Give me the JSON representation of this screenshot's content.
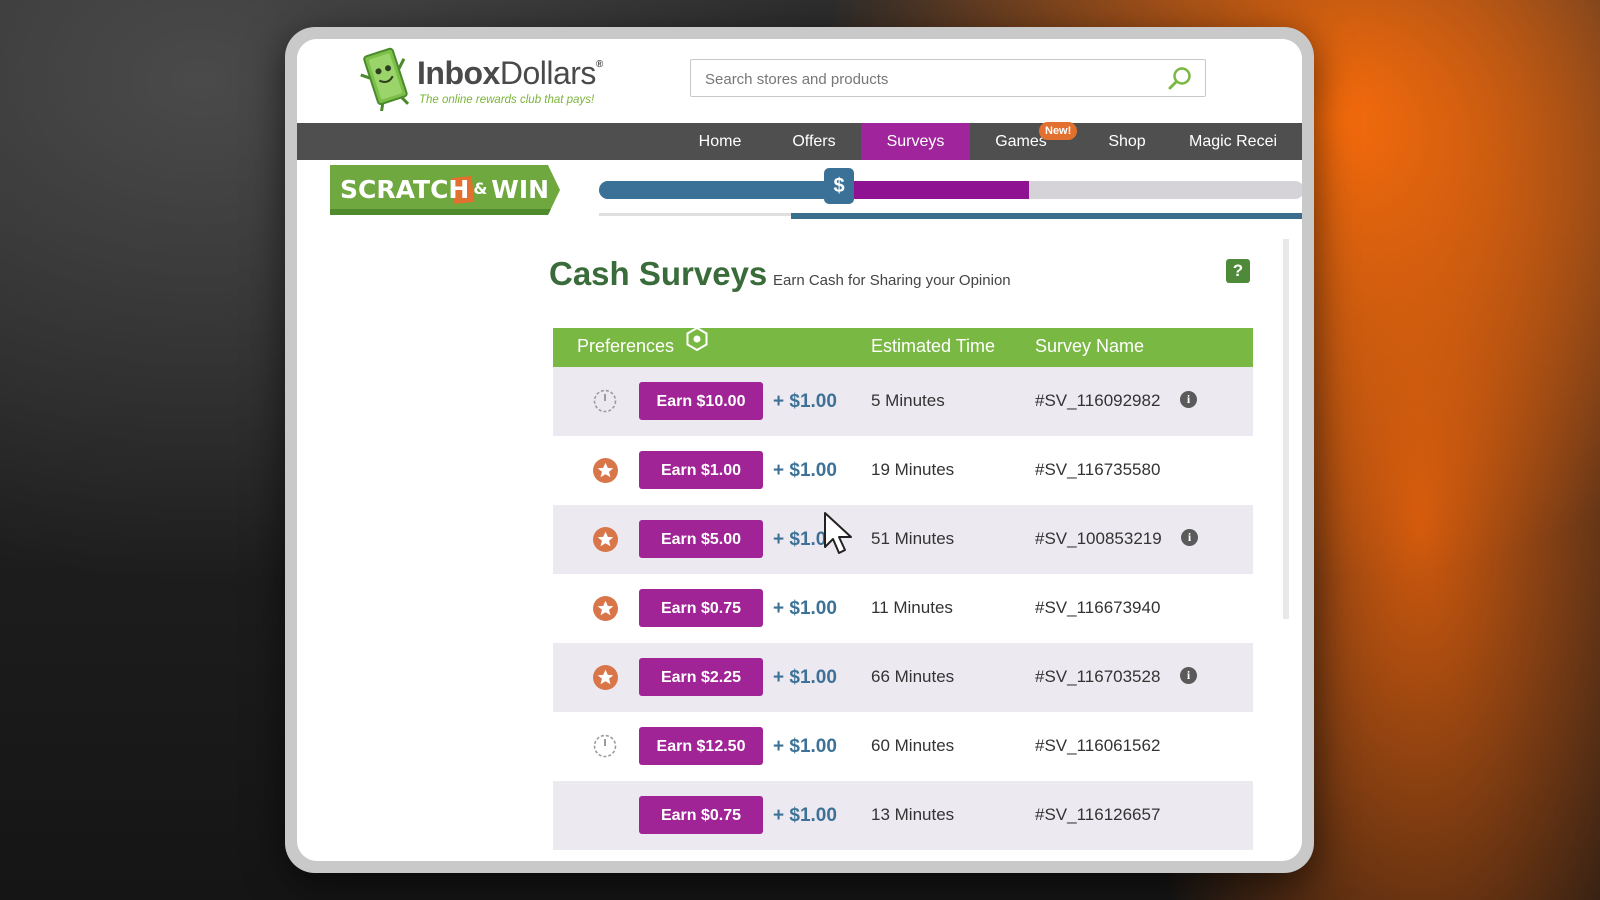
{
  "brand": {
    "name_bold": "Inbox",
    "name_light": "Dollars",
    "registered": "®",
    "tagline": "The online rewards club that pays!"
  },
  "search": {
    "placeholder": "Search stores and products",
    "icon": "search-icon"
  },
  "nav": {
    "items": [
      {
        "label": "Home"
      },
      {
        "label": "Offers"
      },
      {
        "label": "Surveys",
        "active": true
      },
      {
        "label": "Games",
        "badge": "New!"
      },
      {
        "label": "Shop"
      },
      {
        "label": "Magic Recei"
      }
    ]
  },
  "scratch_win": {
    "label_left": "SCRATCH",
    "label_amp": "&",
    "label_right": "WIN",
    "marker": "$",
    "progress_marker_fraction": 0.34,
    "progress_fill_fraction": 0.61
  },
  "page": {
    "title": "Cash Surveys",
    "subtitle": "Earn Cash for Sharing your Opinion",
    "help": "?"
  },
  "table": {
    "headers": {
      "preferences": "Preferences",
      "time": "Estimated Time",
      "name": "Survey Name"
    },
    "rows": [
      {
        "icon": "clock-icon",
        "earn": "Earn $10.00",
        "bonus": "+ $1.00",
        "time": "5 Minutes",
        "name": "#SV_116092982",
        "info": true
      },
      {
        "icon": "star-icon",
        "earn": "Earn $1.00",
        "bonus": "+ $1.00",
        "time": "19 Minutes",
        "name": "#SV_116735580",
        "info": false
      },
      {
        "icon": "star-icon",
        "earn": "Earn $5.00",
        "bonus": "+ $1.0",
        "time": "51 Minutes",
        "name": "#SV_100853219",
        "info": true
      },
      {
        "icon": "star-icon",
        "earn": "Earn $0.75",
        "bonus": "+ $1.00",
        "time": "11 Minutes",
        "name": "#SV_116673940",
        "info": false
      },
      {
        "icon": "star-icon",
        "earn": "Earn $2.25",
        "bonus": "+ $1.00",
        "time": "66 Minutes",
        "name": "#SV_116703528",
        "info": true
      },
      {
        "icon": "clock-icon",
        "earn": "Earn $12.50",
        "bonus": "+ $1.00",
        "time": "60 Minutes",
        "name": "#SV_116061562",
        "info": false
      },
      {
        "icon": "none",
        "earn": "Earn $0.75",
        "bonus": "+ $1.00",
        "time": "13 Minutes",
        "name": "#SV_116126657",
        "info": false
      }
    ]
  },
  "colors": {
    "nav_bg": "#4f4f4f",
    "active_tab": "#a0249b",
    "table_header": "#7ab844",
    "earn_button": "#a02496",
    "bonus_text": "#3d7296",
    "star": "#d8764a",
    "row_alt": "#ede9f0"
  }
}
